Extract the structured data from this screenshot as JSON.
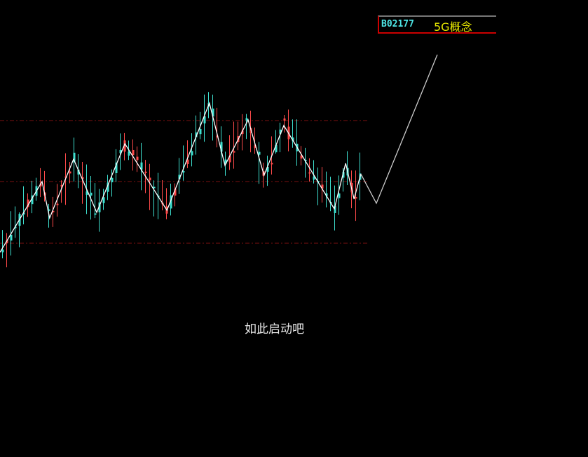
{
  "caption": "如此启动吧",
  "info": {
    "code": "B02177",
    "concept": "5G概念"
  },
  "colors": {
    "up": "#ff4a4a",
    "down": "#3ee0d0",
    "zigzag": "#ffffff",
    "projection": "#cccccc",
    "grid": "#7a1010"
  },
  "chart_data": {
    "type": "line",
    "title": "",
    "xlabel": "",
    "ylabel": "",
    "xlim": [
      0,
      140
    ],
    "ylim": [
      -25,
      40
    ],
    "reference_levels": [
      22.8,
      14.1,
      5.3
    ],
    "zigzag": [
      [
        0,
        4
      ],
      [
        10,
        14.1
      ],
      [
        11.8,
        8.9
      ],
      [
        17.5,
        17.3
      ],
      [
        23,
        9.7
      ],
      [
        29.7,
        19.5
      ],
      [
        39.7,
        10
      ],
      [
        49.8,
        25.3
      ],
      [
        53.5,
        16.4
      ],
      [
        59,
        22.9
      ],
      [
        62.8,
        15
      ],
      [
        67.5,
        22.1
      ],
      [
        79.5,
        10.2
      ],
      [
        82.2,
        16.7
      ],
      [
        84.2,
        11.6
      ],
      [
        85.8,
        15.2
      ]
    ],
    "projection": [
      [
        85.8,
        15.2
      ],
      [
        89.5,
        11
      ],
      [
        104,
        32.2
      ]
    ],
    "candle_count": 86
  }
}
